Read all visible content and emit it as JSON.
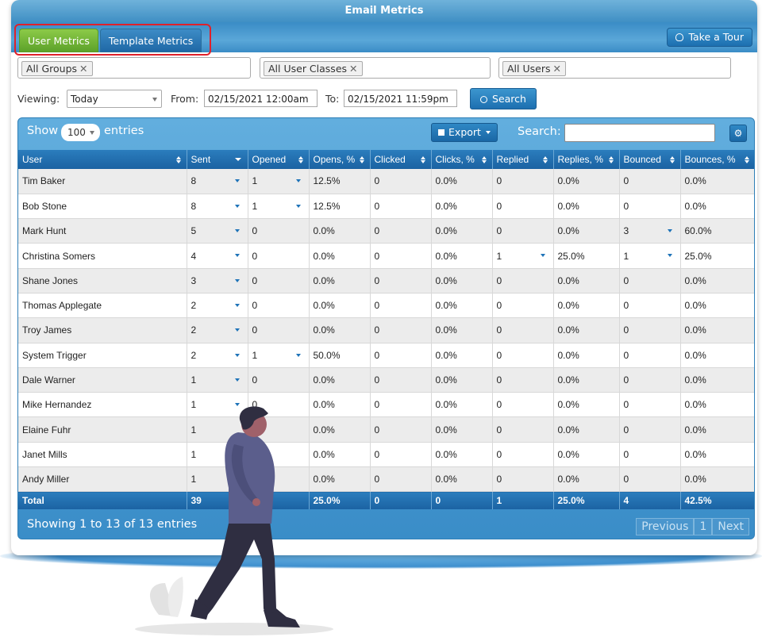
{
  "window": {
    "title": "Email Metrics"
  },
  "tabs": [
    {
      "label": "User Metrics",
      "active": true
    },
    {
      "label": "Template Metrics",
      "active": false
    }
  ],
  "tour_button": {
    "label": "Take a Tour",
    "icon": "lightbulb-icon"
  },
  "filters": {
    "groups": "All Groups",
    "user_classes": "All User Classes",
    "users": "All Users"
  },
  "viewing": {
    "label": "Viewing:",
    "value": "Today",
    "from_label": "From:",
    "from_value": "02/15/2021 12:00am",
    "to_label": "To:",
    "to_value": "02/15/2021 11:59pm",
    "search_label": "Search"
  },
  "table_controls": {
    "show_label": "Show",
    "show_value": "100",
    "entries_label": "entries",
    "export_label": "Export",
    "search_label": "Search:",
    "gear_icon": "gear-icon"
  },
  "columns": [
    "User",
    "Sent",
    "Opened",
    "Opens, %",
    "Clicked",
    "Clicks, %",
    "Replied",
    "Replies, %",
    "Bounced",
    "Bounces, %"
  ],
  "rows": [
    {
      "user": "Tim Baker",
      "sent": "8",
      "opened": "1",
      "opens_pct": "12.5%",
      "clicked": "0",
      "clicks_pct": "0.0%",
      "replied": "0",
      "replies_pct": "0.0%",
      "bounced": "0",
      "bounces_pct": "0.0%"
    },
    {
      "user": "Bob Stone",
      "sent": "8",
      "opened": "1",
      "opens_pct": "12.5%",
      "clicked": "0",
      "clicks_pct": "0.0%",
      "replied": "0",
      "replies_pct": "0.0%",
      "bounced": "0",
      "bounces_pct": "0.0%"
    },
    {
      "user": "Mark Hunt",
      "sent": "5",
      "opened": "0",
      "opens_pct": "0.0%",
      "clicked": "0",
      "clicks_pct": "0.0%",
      "replied": "0",
      "replies_pct": "0.0%",
      "bounced": "3",
      "bounces_pct": "60.0%"
    },
    {
      "user": "Christina Somers",
      "sent": "4",
      "opened": "0",
      "opens_pct": "0.0%",
      "clicked": "0",
      "clicks_pct": "0.0%",
      "replied": "1",
      "replies_pct": "25.0%",
      "bounced": "1",
      "bounces_pct": "25.0%"
    },
    {
      "user": "Shane Jones",
      "sent": "3",
      "opened": "0",
      "opens_pct": "0.0%",
      "clicked": "0",
      "clicks_pct": "0.0%",
      "replied": "0",
      "replies_pct": "0.0%",
      "bounced": "0",
      "bounces_pct": "0.0%"
    },
    {
      "user": "Thomas Applegate",
      "sent": "2",
      "opened": "0",
      "opens_pct": "0.0%",
      "clicked": "0",
      "clicks_pct": "0.0%",
      "replied": "0",
      "replies_pct": "0.0%",
      "bounced": "0",
      "bounces_pct": "0.0%"
    },
    {
      "user": "Troy James",
      "sent": "2",
      "opened": "0",
      "opens_pct": "0.0%",
      "clicked": "0",
      "clicks_pct": "0.0%",
      "replied": "0",
      "replies_pct": "0.0%",
      "bounced": "0",
      "bounces_pct": "0.0%"
    },
    {
      "user": "System Trigger",
      "sent": "2",
      "opened": "1",
      "opens_pct": "50.0%",
      "clicked": "0",
      "clicks_pct": "0.0%",
      "replied": "0",
      "replies_pct": "0.0%",
      "bounced": "0",
      "bounces_pct": "0.0%"
    },
    {
      "user": "Dale Warner",
      "sent": "1",
      "opened": "0",
      "opens_pct": "0.0%",
      "clicked": "0",
      "clicks_pct": "0.0%",
      "replied": "0",
      "replies_pct": "0.0%",
      "bounced": "0",
      "bounces_pct": "0.0%"
    },
    {
      "user": "Mike Hernandez",
      "sent": "1",
      "opened": "0",
      "opens_pct": "0.0%",
      "clicked": "0",
      "clicks_pct": "0.0%",
      "replied": "0",
      "replies_pct": "0.0%",
      "bounced": "0",
      "bounces_pct": "0.0%"
    },
    {
      "user": "Elaine Fuhr",
      "sent": "1",
      "opened": "",
      "opens_pct": "0.0%",
      "clicked": "0",
      "clicks_pct": "0.0%",
      "replied": "0",
      "replies_pct": "0.0%",
      "bounced": "0",
      "bounces_pct": "0.0%"
    },
    {
      "user": "Janet Mills",
      "sent": "1",
      "opened": "",
      "opens_pct": "0.0%",
      "clicked": "0",
      "clicks_pct": "0.0%",
      "replied": "0",
      "replies_pct": "0.0%",
      "bounced": "0",
      "bounces_pct": "0.0%"
    },
    {
      "user": "Andy Miller",
      "sent": "1",
      "opened": "",
      "opens_pct": "0.0%",
      "clicked": "0",
      "clicks_pct": "0.0%",
      "replied": "0",
      "replies_pct": "0.0%",
      "bounced": "0",
      "bounces_pct": "0.0%"
    }
  ],
  "total": {
    "user": "Total",
    "sent": "39",
    "opened": "",
    "opens_pct": "25.0%",
    "clicked": "0",
    "clicks_pct": "0",
    "replied": "1",
    "replies_pct": "25.0%",
    "bounced": "4",
    "bounces_pct": "42.5%"
  },
  "footer": {
    "info": "Showing 1 to 13 of 13 entries",
    "previous": "Previous",
    "page": "1",
    "next": "Next"
  },
  "colors": {
    "header_blue": "#1b62a2",
    "active_tab_green": "#5da22a",
    "highlight_red": "#e0202a"
  }
}
